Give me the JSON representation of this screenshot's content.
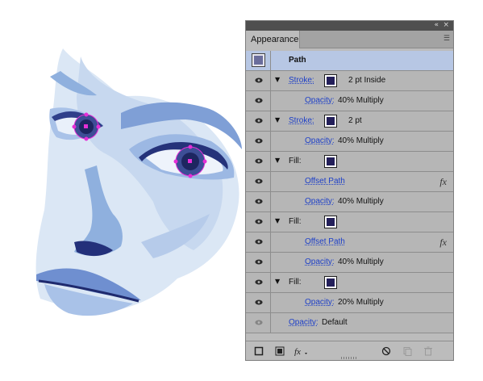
{
  "panel": {
    "title": "Appearance",
    "topbar": {
      "collapse_icon": "double-chevron-left-icon",
      "close_icon": "close-icon"
    },
    "menu_icon": "panel-menu-icon",
    "header": {
      "label": "Path"
    },
    "rows": [
      {
        "type": "stroke",
        "label": "Stroke:",
        "value": "2 pt  Inside",
        "swatch": "#231f5a"
      },
      {
        "type": "opacity",
        "label": "Opacity:",
        "value": "40% Multiply"
      },
      {
        "type": "stroke",
        "label": "Stroke:",
        "value": "2 pt",
        "swatch": "#231f5a"
      },
      {
        "type": "opacity",
        "label": "Opacity:",
        "value": "40% Multiply"
      },
      {
        "type": "fill",
        "label": "Fill:",
        "swatch": "#231f5a"
      },
      {
        "type": "effect",
        "label": "Offset Path",
        "icon": "fx-icon"
      },
      {
        "type": "opacity",
        "label": "Opacity:",
        "value": "40% Multiply"
      },
      {
        "type": "fill",
        "label": "Fill:",
        "swatch": "#231f5a"
      },
      {
        "type": "effect",
        "label": "Offset Path",
        "icon": "fx-icon"
      },
      {
        "type": "opacity",
        "label": "Opacity:",
        "value": "40% Multiply"
      },
      {
        "type": "fill",
        "label": "Fill:",
        "swatch": "#231f5a"
      },
      {
        "type": "opacity",
        "label": "Opacity:",
        "value": "20% Multiply"
      }
    ],
    "footer_opacity": {
      "label": "Opacity:",
      "value": "Default"
    },
    "footer_icons": [
      "add-stroke-icon",
      "add-fill-icon",
      "fx-menu-icon",
      "clear-appearance-icon",
      "duplicate-item-icon",
      "delete-item-icon"
    ]
  },
  "colors": {
    "panel_bg": "#bcbcbc",
    "header_row": "#b7c7e4",
    "link": "#1d3fc8",
    "selection": "#e52fd6"
  }
}
